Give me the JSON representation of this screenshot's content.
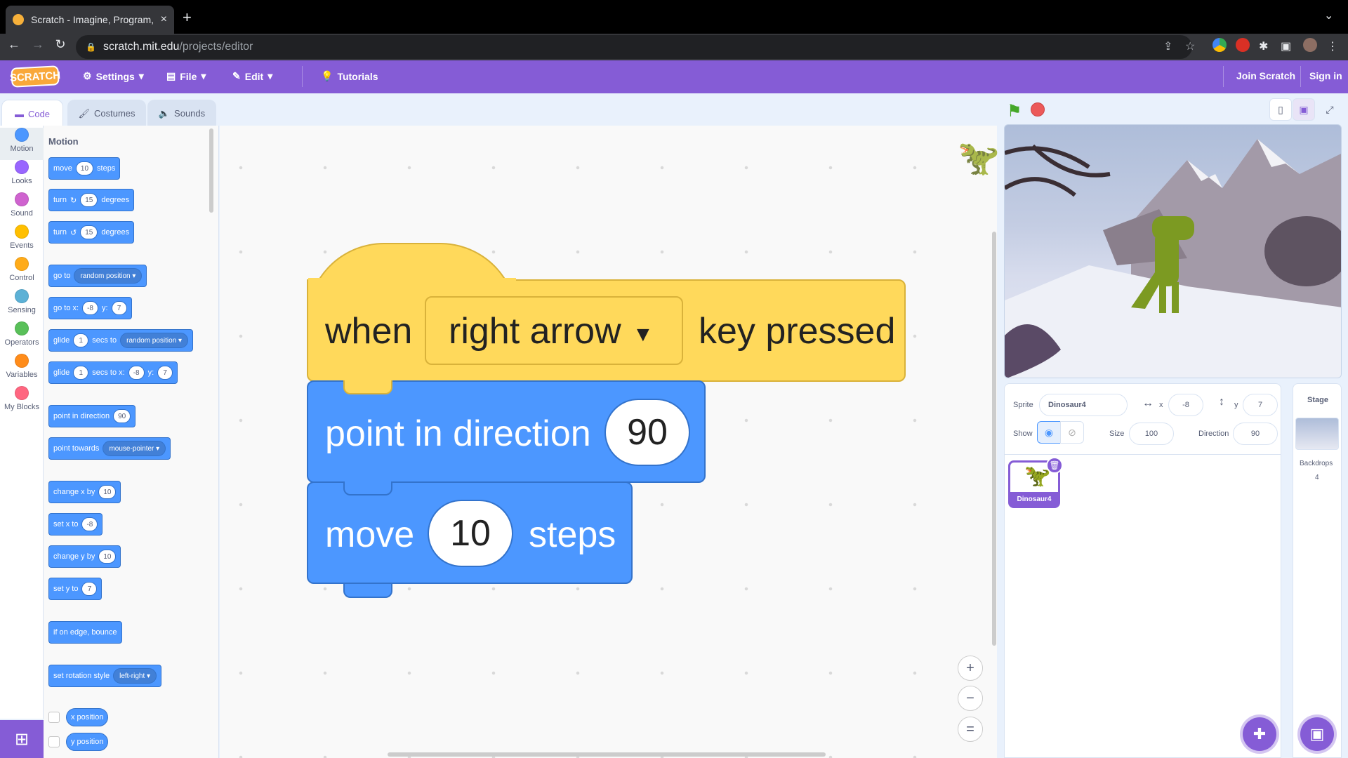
{
  "browser": {
    "tab_title": "Scratch - Imagine, Program, Sh",
    "url_host": "scratch.mit.edu",
    "url_path": "/projects/editor",
    "new_tab": "+",
    "close_tab": "×"
  },
  "menu": {
    "logo": "SCRATCH",
    "settings": "Settings",
    "file": "File",
    "edit": "Edit",
    "tutorials": "Tutorials",
    "join": "Join Scratch",
    "signin": "Sign in"
  },
  "tabs": {
    "code": "Code",
    "costumes": "Costumes",
    "sounds": "Sounds"
  },
  "categories": [
    {
      "label": "Motion",
      "color": "#4c97ff"
    },
    {
      "label": "Looks",
      "color": "#9966ff"
    },
    {
      "label": "Sound",
      "color": "#cf63cf"
    },
    {
      "label": "Events",
      "color": "#ffbf00"
    },
    {
      "label": "Control",
      "color": "#ffab19"
    },
    {
      "label": "Sensing",
      "color": "#5cb1d6"
    },
    {
      "label": "Operators",
      "color": "#59c059"
    },
    {
      "label": "Variables",
      "color": "#ff8c1a"
    },
    {
      "label": "My Blocks",
      "color": "#ff6680"
    }
  ],
  "palette": {
    "title": "Motion",
    "move": {
      "a": "move",
      "v": "10",
      "b": "steps"
    },
    "turn_right": {
      "a": "turn",
      "v": "15",
      "b": "degrees"
    },
    "turn_left": {
      "a": "turn",
      "v": "15",
      "b": "degrees"
    },
    "goto": {
      "a": "go to",
      "dd": "random position"
    },
    "goto_xy": {
      "a": "go to x:",
      "x": "-8",
      "b": "y:",
      "y": "7"
    },
    "glide_to": {
      "a": "glide",
      "v": "1",
      "b": "secs to",
      "dd": "random position"
    },
    "glide_xy": {
      "a": "glide",
      "v": "1",
      "b": "secs to x:",
      "x": "-8",
      "c": "y:",
      "y": "7"
    },
    "point_dir": {
      "a": "point in direction",
      "v": "90"
    },
    "point_towards": {
      "a": "point towards",
      "dd": "mouse-pointer"
    },
    "change_x": {
      "a": "change x by",
      "v": "10"
    },
    "set_x": {
      "a": "set x to",
      "v": "-8"
    },
    "change_y": {
      "a": "change y by",
      "v": "10"
    },
    "set_y": {
      "a": "set y to",
      "v": "7"
    },
    "bounce": {
      "a": "if on edge, bounce"
    },
    "rot_style": {
      "a": "set rotation style",
      "dd": "left-right"
    },
    "x_pos": "x position",
    "y_pos": "y position"
  },
  "script": {
    "hat_when": "when",
    "hat_key": "right arrow",
    "hat_pressed": "key pressed",
    "point_label": "point in direction",
    "point_value": "90",
    "move_label": "move",
    "move_value": "10",
    "move_steps": "steps"
  },
  "zoom": {
    "in": "+",
    "out": "−",
    "reset": "="
  },
  "sprite": {
    "sprite_label": "Sprite",
    "name": "Dinosaur4",
    "x_label": "x",
    "x": "-8",
    "y_label": "y",
    "y": "7",
    "show_label": "Show",
    "size_label": "Size",
    "size": "100",
    "direction_label": "Direction",
    "direction": "90",
    "thumb_name": "Dinosaur4"
  },
  "stage_panel": {
    "title": "Stage",
    "backdrops_label": "Backdrops",
    "backdrops_count": "4"
  },
  "colors": {
    "scratch_purple": "#855cd6",
    "motion_blue": "#4c97ff",
    "events_yellow": "#ffd95b"
  }
}
